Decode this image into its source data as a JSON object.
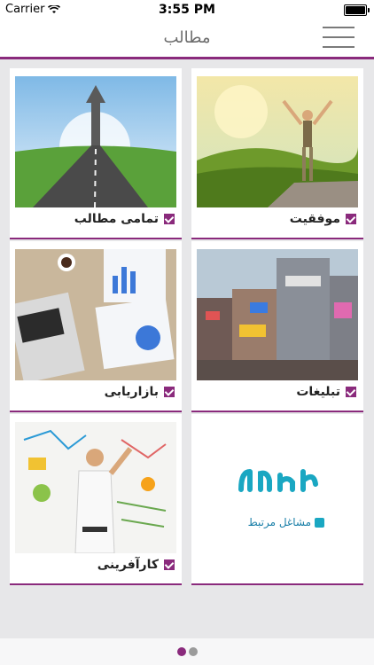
{
  "status_bar": {
    "carrier": "Carrier",
    "time": "3:55 PM"
  },
  "header": {
    "title": "مطالب",
    "menu_icon": "hamburger-icon"
  },
  "accent_color": "#8a2a7c",
  "cards": [
    {
      "label": "موفقیت",
      "image": "success-photo"
    },
    {
      "label": "تمامی مطالب",
      "image": "road-arrow-photo"
    },
    {
      "label": "تبلیغات",
      "image": "city-billboards-photo"
    },
    {
      "label": "بازاریابی",
      "image": "marketing-desk-photo"
    },
    {
      "label": "مشاغل مرتبط",
      "image": "logo-card"
    },
    {
      "label": "کارآفرینی",
      "image": "whiteboard-photo"
    }
  ],
  "pagination": {
    "pages": 2,
    "current": 1
  }
}
